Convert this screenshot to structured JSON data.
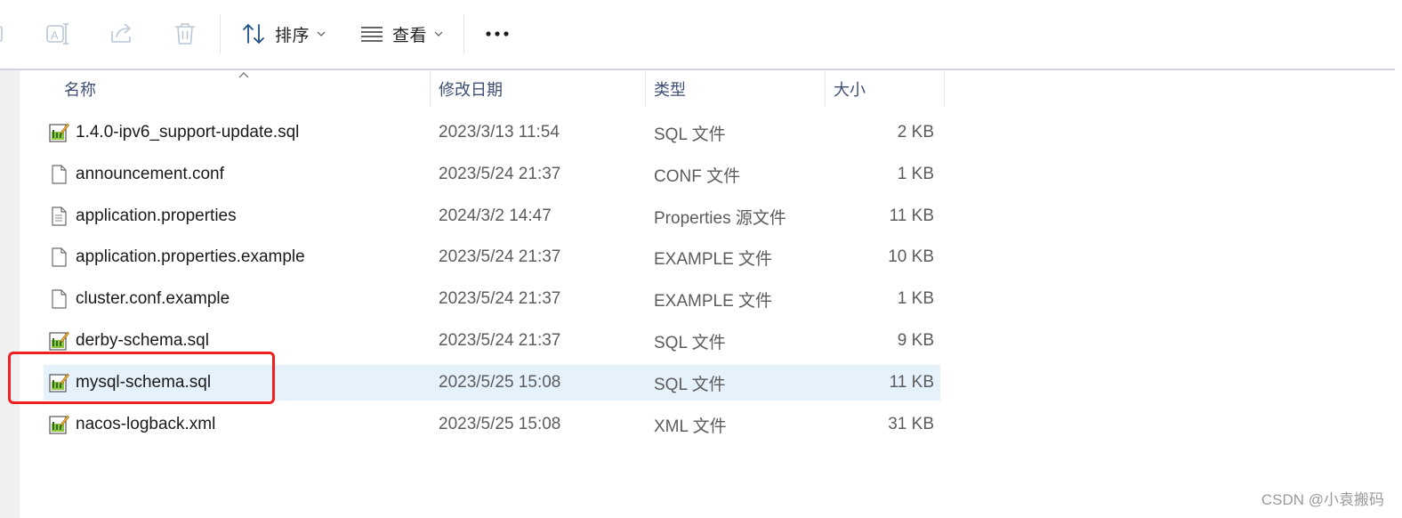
{
  "toolbar": {
    "sort_label": "排序",
    "view_label": "查看"
  },
  "columns": {
    "name": "名称",
    "date": "修改日期",
    "type": "类型",
    "size": "大小"
  },
  "files": [
    {
      "name": "1.4.0-ipv6_support-update.sql",
      "date": "2023/3/13 11:54",
      "type": "SQL 文件",
      "size": "2 KB",
      "icon": "sql-file-icon"
    },
    {
      "name": "announcement.conf",
      "date": "2023/5/24 21:37",
      "type": "CONF 文件",
      "size": "1 KB",
      "icon": "blank-file-icon"
    },
    {
      "name": "application.properties",
      "date": "2024/3/2 14:47",
      "type": "Properties 源文件",
      "size": "11 KB",
      "icon": "text-file-icon"
    },
    {
      "name": "application.properties.example",
      "date": "2023/5/24 21:37",
      "type": "EXAMPLE 文件",
      "size": "10 KB",
      "icon": "blank-file-icon"
    },
    {
      "name": "cluster.conf.example",
      "date": "2023/5/24 21:37",
      "type": "EXAMPLE 文件",
      "size": "1 KB",
      "icon": "blank-file-icon"
    },
    {
      "name": "derby-schema.sql",
      "date": "2023/5/24 21:37",
      "type": "SQL 文件",
      "size": "9 KB",
      "icon": "sql-file-icon"
    },
    {
      "name": "mysql-schema.sql",
      "date": "2023/5/25 15:08",
      "type": "SQL 文件",
      "size": "11 KB",
      "icon": "sql-file-icon",
      "selected": true
    },
    {
      "name": "nacos-logback.xml",
      "date": "2023/5/25 15:08",
      "type": "XML 文件",
      "size": "31 KB",
      "icon": "sql-file-icon"
    }
  ],
  "watermark": "CSDN @小袁搬码",
  "colors": {
    "selected_row": "#e5f1fb",
    "highlight_box": "#f02020",
    "header_text": "#3e4f73"
  }
}
